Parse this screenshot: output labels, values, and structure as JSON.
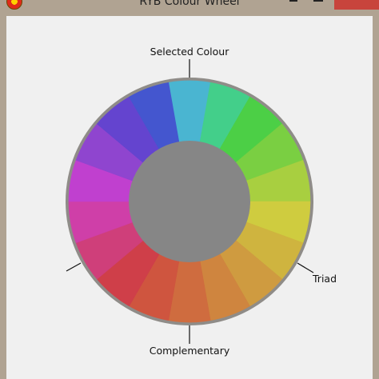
{
  "window": {
    "title": "RYB Colour Wheel"
  },
  "labels": {
    "selected": "Selected Colour",
    "triad": "Triad",
    "complementary": "Complementary"
  },
  "wheel": {
    "segments": [
      "#4ab5d1",
      "#43cf8a",
      "#4ccf46",
      "#7acf42",
      "#a8cf40",
      "#cfcc3f",
      "#cfb43f",
      "#cf9b40",
      "#cf853f",
      "#cf6c3f",
      "#cf553f",
      "#cf3f49",
      "#cf3f7a",
      "#cf3fa8",
      "#c040cf",
      "#8f45cf",
      "#6444cf",
      "#4456cf"
    ],
    "rim_color": "#8f8c88",
    "hub_color": "#868686"
  }
}
